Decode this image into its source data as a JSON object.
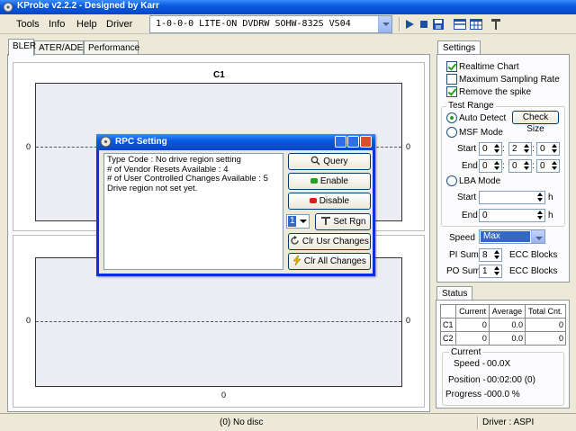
{
  "window": {
    "title": "KProbe v2.2.2 - Designed by Karr"
  },
  "menu": [
    "Tools",
    "Info",
    "Help",
    "Driver"
  ],
  "drive_select": {
    "value": "1-0-0-0 LITE-ON DVDRW SOHW-832S  VS04"
  },
  "tabs": [
    "BLER",
    "ATER/ADER",
    "Performance"
  ],
  "charts": {
    "top": {
      "title": "C1",
      "y_left": "0",
      "y_right": "0"
    },
    "bottom": {
      "y_left": "0",
      "y_right": "0",
      "x_label": "0"
    }
  },
  "settings": {
    "tab": "Settings",
    "checks": [
      {
        "label": "Realtime Chart",
        "checked": true
      },
      {
        "label": "Maximum Sampling Rate",
        "checked": false
      },
      {
        "label": "Remove the spike",
        "checked": true
      }
    ],
    "test_range": {
      "title": "Test Range",
      "auto_detect": "Auto Detect",
      "check_size": "Check Size",
      "msf_mode": "MSF Mode",
      "start_label": "Start",
      "end_label": "End",
      "msf_start": [
        "0",
        "2",
        "0"
      ],
      "msf_end": [
        "0",
        "0",
        "0"
      ],
      "lba_mode": "LBA Mode",
      "lba_start": "",
      "lba_end": "0",
      "h_unit": "h"
    },
    "speed_label": "Speed",
    "speed_value": "Max",
    "pi_sum_label": "PI Sum",
    "pi_sum_value": "8",
    "po_sum_label": "PO Sum",
    "po_sum_value": "1",
    "ecc_blocks": "ECC Blocks"
  },
  "status": {
    "tab": "Status",
    "headers": [
      "",
      "Current",
      "Average",
      "Total Cnt."
    ],
    "rows": [
      [
        "C1",
        "0",
        "0.0",
        "0"
      ],
      [
        "C2",
        "0",
        "0.0",
        "0"
      ]
    ],
    "current_title": "Current",
    "speed_label": "Speed -",
    "speed_value": "00.0X",
    "position_label": "Position -",
    "position_value": "00:02:00 (0)",
    "progress_label": "Progress -",
    "progress_value": "000.0 %"
  },
  "statusbar": {
    "disc": "(0) No disc",
    "driver": "Driver : ASPI"
  },
  "dialog": {
    "title": "RPC Setting",
    "lines": [
      "Type Code : No drive region setting",
      "# of Vendor Resets Available : 4",
      "# of User Controlled Changes Available : 5",
      "Drive region not set yet."
    ],
    "buttons": {
      "query": "Query",
      "enable": "Enable",
      "disable": "Disable",
      "region_value": "1",
      "set_rgn": "Set Rgn",
      "clr_usr": "Clr Usr Changes",
      "clr_all": "Clr All Changes"
    }
  },
  "colors": {
    "title_blue": "#0a5ae0",
    "plot_bg": "#ececf4",
    "enable_green": "#21a121",
    "disable_red": "#d62020"
  }
}
